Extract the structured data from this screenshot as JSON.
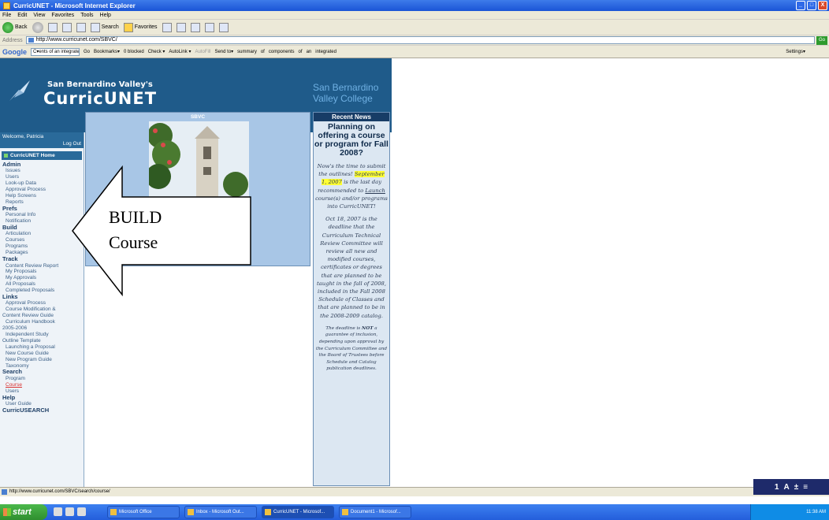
{
  "window": {
    "title": "CurricUNET - Microsoft Internet Explorer",
    "minimize": "_",
    "maximize": "□",
    "close": "X"
  },
  "menu": [
    "File",
    "Edit",
    "View",
    "Favorites",
    "Tools",
    "Help"
  ],
  "toolbar": {
    "back": "Back",
    "search": "Search",
    "favorites": "Favorites"
  },
  "address": {
    "label": "Address",
    "url": "http://www.curricunet.com/SBVC/",
    "go": "Go"
  },
  "googlebar": {
    "logo": "Google",
    "search_text": "C▾ents of an integrated",
    "items": [
      "Go",
      "Bookmarks▾",
      "0 blocked",
      "Check ▾",
      "AutoLink ▾",
      "AutoFill",
      "Send to▾",
      "summary",
      "of",
      "components",
      "of",
      "an",
      "integrated"
    ],
    "settings": "Settings▾"
  },
  "banner": {
    "org": "San Bernardino Valley's",
    "app": "CurricUNET",
    "college_line1": "San Bernardino",
    "college_line2": "Valley College"
  },
  "sidebar": {
    "welcome": "Welcome, Patricia",
    "logout": "Log Out",
    "home": "CurricUNET Home",
    "nav": [
      {
        "type": "sec",
        "label": "Admin"
      },
      {
        "type": "item",
        "label": "Issues"
      },
      {
        "type": "item",
        "label": "Users"
      },
      {
        "type": "item",
        "label": "Look-up Data"
      },
      {
        "type": "item",
        "label": "Approval Process"
      },
      {
        "type": "item",
        "label": "Help Screens"
      },
      {
        "type": "item",
        "label": "Reports"
      },
      {
        "type": "sec",
        "label": "Prefs"
      },
      {
        "type": "item",
        "label": "Personal Info"
      },
      {
        "type": "item",
        "label": "Notification"
      },
      {
        "type": "sec",
        "label": "Build"
      },
      {
        "type": "item",
        "label": "Articulation"
      },
      {
        "type": "item",
        "label": "Courses"
      },
      {
        "type": "item",
        "label": "Programs"
      },
      {
        "type": "item",
        "label": "Packages"
      },
      {
        "type": "sec",
        "label": "Track"
      },
      {
        "type": "item",
        "label": "Content Review Report"
      },
      {
        "type": "item",
        "label": "My Proposals"
      },
      {
        "type": "item",
        "label": "My Approvals"
      },
      {
        "type": "item",
        "label": "All Proposals"
      },
      {
        "type": "item",
        "label": "Completed Proposals"
      },
      {
        "type": "sec",
        "label": "Links"
      },
      {
        "type": "item",
        "label": "Approval Process"
      },
      {
        "type": "item",
        "label": "Course Modification &"
      },
      {
        "type": "flush",
        "label": "Content Review Guide"
      },
      {
        "type": "item",
        "label": "Curriculum Handbook"
      },
      {
        "type": "flush",
        "label": "2005-2006"
      },
      {
        "type": "item",
        "label": "Independent Study"
      },
      {
        "type": "flush",
        "label": "Outline Template"
      },
      {
        "type": "item",
        "label": "Launching a Proposal"
      },
      {
        "type": "item",
        "label": "New Course Guide"
      },
      {
        "type": "item",
        "label": "New Program Guide"
      },
      {
        "type": "item",
        "label": "Taxonomy"
      },
      {
        "type": "sec",
        "label": "Search"
      },
      {
        "type": "item",
        "label": "Program"
      },
      {
        "type": "active",
        "label": "Course"
      },
      {
        "type": "item",
        "label": "Users"
      },
      {
        "type": "sec",
        "label": "Help"
      },
      {
        "type": "item",
        "label": "User Guide"
      },
      {
        "type": "sec",
        "label": "CurricUSEARCH"
      }
    ]
  },
  "photo_box": {
    "title": "SBVC"
  },
  "news": {
    "header": "Recent News",
    "headline": "Planning on offering a course or program for Fall 2008?",
    "p1_a": "Now's the time to submit the outlines!",
    "p1_hl": "September 1, 2007",
    "p1_b": "is the last day recommended to",
    "p1_link": "Launch",
    "p1_c": "course(s) and/or programs into CurricUNET!",
    "p2": "Oct 18, 2007 is the deadline that the Curriculum Technical Review Committee will review all new and modified courses, certificates or degrees that are planned to be taught in the fall of 2008, included in the Fall 2008 Schedule of Classes and that are planned to be in the 2008-2009 catalog.",
    "p3_a": "The deadline is",
    "p3_not": "NOT",
    "p3_b": "a guarantee of inclusion, depending upon approval by the Curriculum Committee and the Board of Trustees before Schedule and Catalog publication deadlines."
  },
  "overlay": {
    "line1": "BUILD",
    "line2": "Course"
  },
  "status": {
    "url": "http://www.curricunet.com/SBVC/search/course/"
  },
  "langbar": [
    "1",
    "A",
    "±",
    "≡"
  ],
  "taskbar": {
    "start": "start",
    "tasks": [
      "Microsoft Office",
      "Inbox - Microsoft Out...",
      "CurricUNET - Microsof...",
      "Document1 - Microsof..."
    ],
    "clock": "11:38 AM"
  }
}
